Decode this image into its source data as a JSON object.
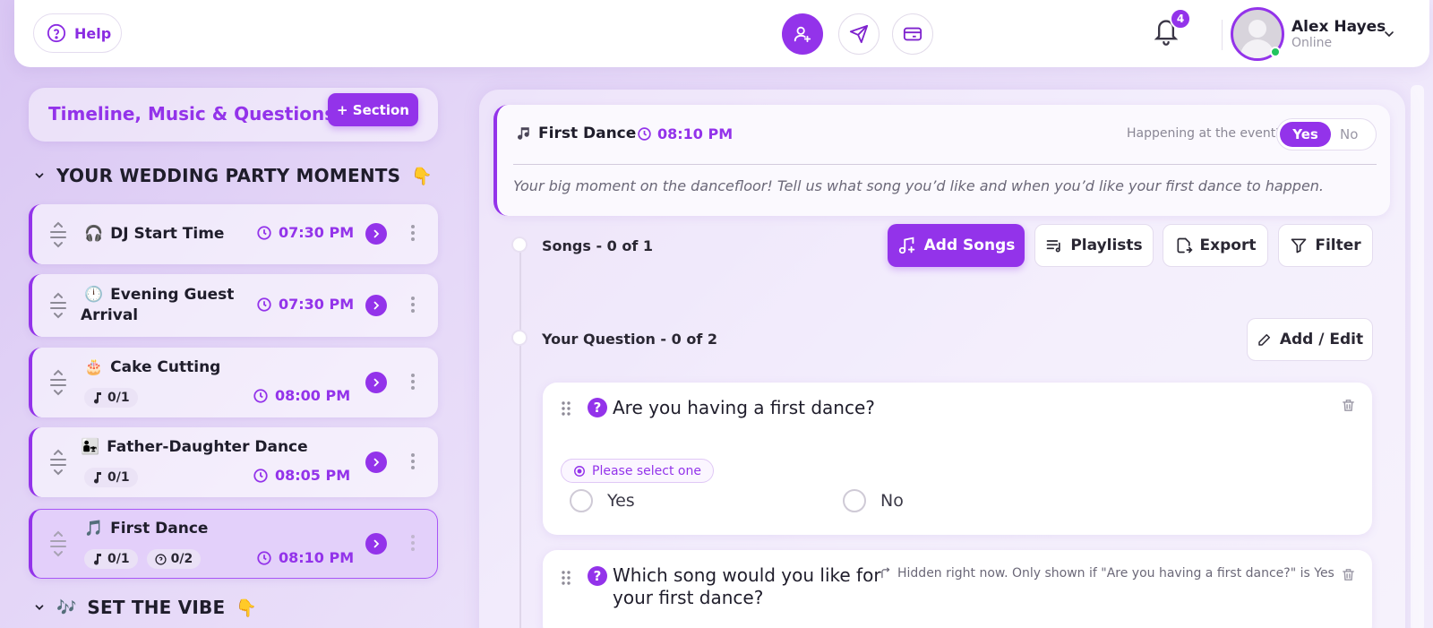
{
  "topbar": {
    "help_label": "Help",
    "notification_count": "4",
    "user": {
      "name": "Alex Hayes",
      "status": "Online"
    }
  },
  "left": {
    "title": "Timeline, Music & Questions",
    "section_button": "+ Section",
    "groups": [
      {
        "title": "YOUR WEDDING PARTY MOMENTS",
        "emoji": "👇"
      },
      {
        "title": "SET THE VIBE",
        "emoji": "👇",
        "icon": "🎶"
      }
    ],
    "moments": [
      {
        "icon": "🎧",
        "title": "DJ Start Time",
        "time": "07:30 PM"
      },
      {
        "icon": "🕛",
        "title": "Evening Guest",
        "title2": "Arrival",
        "time": "07:30 PM"
      },
      {
        "icon": "🎂",
        "title": "Cake Cutting",
        "songs": "0/1",
        "time": "08:00 PM"
      },
      {
        "icon": "👨‍👧",
        "title": "Father-Daughter Dance",
        "songs": "0/1",
        "time": "08:05 PM"
      },
      {
        "icon": "🎵",
        "title": "First Dance",
        "songs": "0/1",
        "questions": "0/2",
        "time": "08:10 PM"
      }
    ]
  },
  "detail": {
    "title": "First Dance",
    "time": "08:10 PM",
    "happening_label": "Happening at the event?",
    "toggle_yes": "Yes",
    "toggle_no": "No",
    "description": "Your big moment on the dancefloor! Tell us what song you’d like and when you’d like your first dance to happen.",
    "songs_label": "Songs - 0 of 1",
    "questions_label": "Your Question - 0 of 2",
    "actions": {
      "add_songs": "Add Songs",
      "playlists": "Playlists",
      "export": "Export",
      "filter": "Filter",
      "add_edit": "Add / Edit"
    },
    "questions": [
      {
        "text": "Are you having a first dance?",
        "hint": "Please select one",
        "options": [
          "Yes",
          "No"
        ]
      },
      {
        "text_line1": "Which song would you like for",
        "text_line2": "your first dance?",
        "note": "Hidden right now. Only shown if \"Are you having a first dance?\" is Yes"
      }
    ]
  },
  "colors": {
    "accent": "#9333ea",
    "online": "#22c55e"
  }
}
